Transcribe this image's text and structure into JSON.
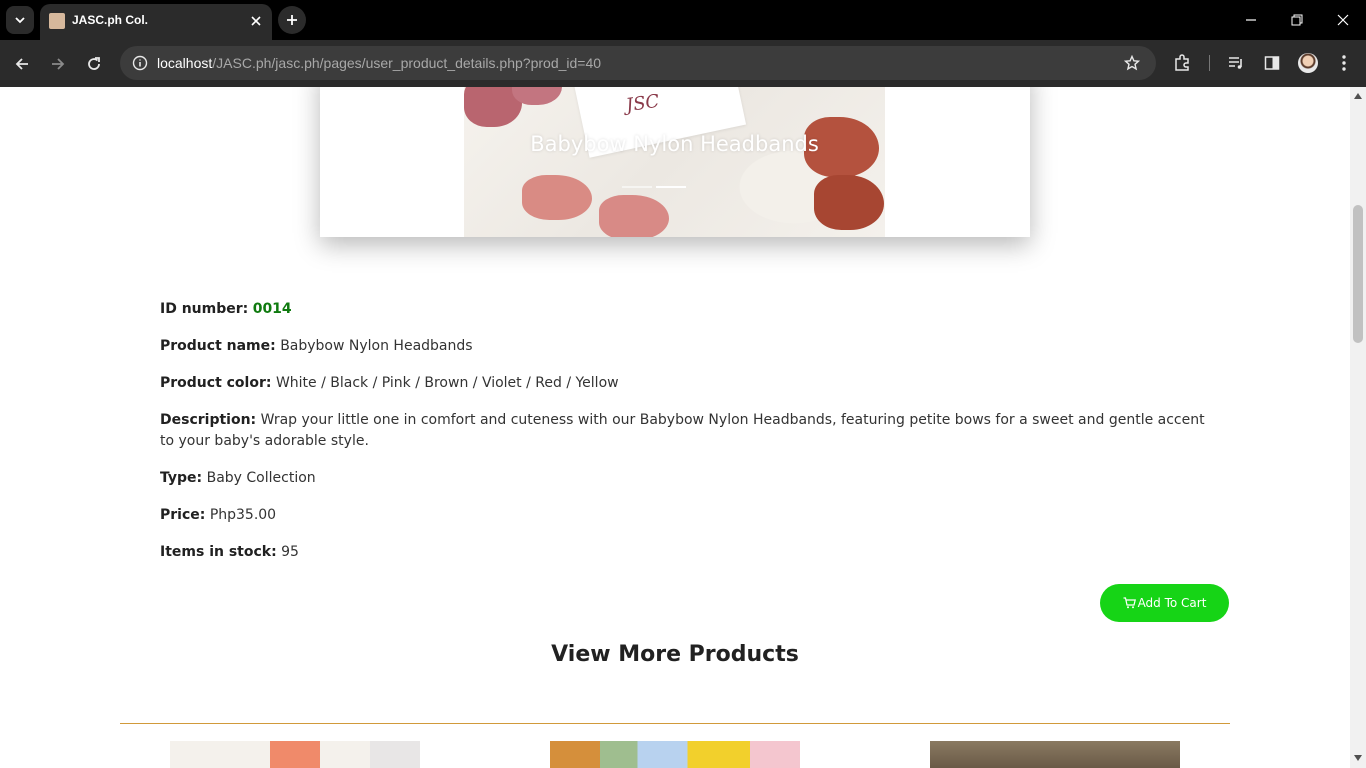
{
  "browser": {
    "tab_title": "JASC.ph Col.",
    "url_host": "localhost",
    "url_path": "/JASC.ph/jasc.ph/pages/user_product_details.php?prod_id=40"
  },
  "hero": {
    "caption": "Babybow Nylon Headbands",
    "logo_text": "JSC"
  },
  "product": {
    "id_label": "ID number:",
    "id_value": "0014",
    "name_label": "Product name:",
    "name_value": "Babybow Nylon Headbands",
    "color_label": "Product color:",
    "color_value": "White / Black / Pink / Brown / Violet / Red / Yellow",
    "description_label": "Description:",
    "description_value": "Wrap your little one in comfort and cuteness with our Babybow Nylon Headbands, featuring petite bows for a sweet and gentle accent to your baby's adorable style.",
    "type_label": "Type:",
    "type_value": "Baby Collection",
    "price_label": "Price:",
    "price_value": "Php35.00",
    "stock_label": "Items in stock:",
    "stock_value": "95"
  },
  "actions": {
    "add_to_cart": "Add To Cart"
  },
  "more": {
    "title": "View More Products"
  },
  "colors": {
    "add_to_cart_bg": "#16d416",
    "id_value": "#0f7a0f",
    "divider": "#d19a3a"
  },
  "icons": [
    "chevron-down-icon",
    "close-icon",
    "plus-icon",
    "back-icon",
    "forward-icon",
    "reload-icon",
    "info-icon",
    "star-icon",
    "extensions-icon",
    "media-icon",
    "side-panel-icon",
    "more-icon",
    "cart-icon"
  ]
}
